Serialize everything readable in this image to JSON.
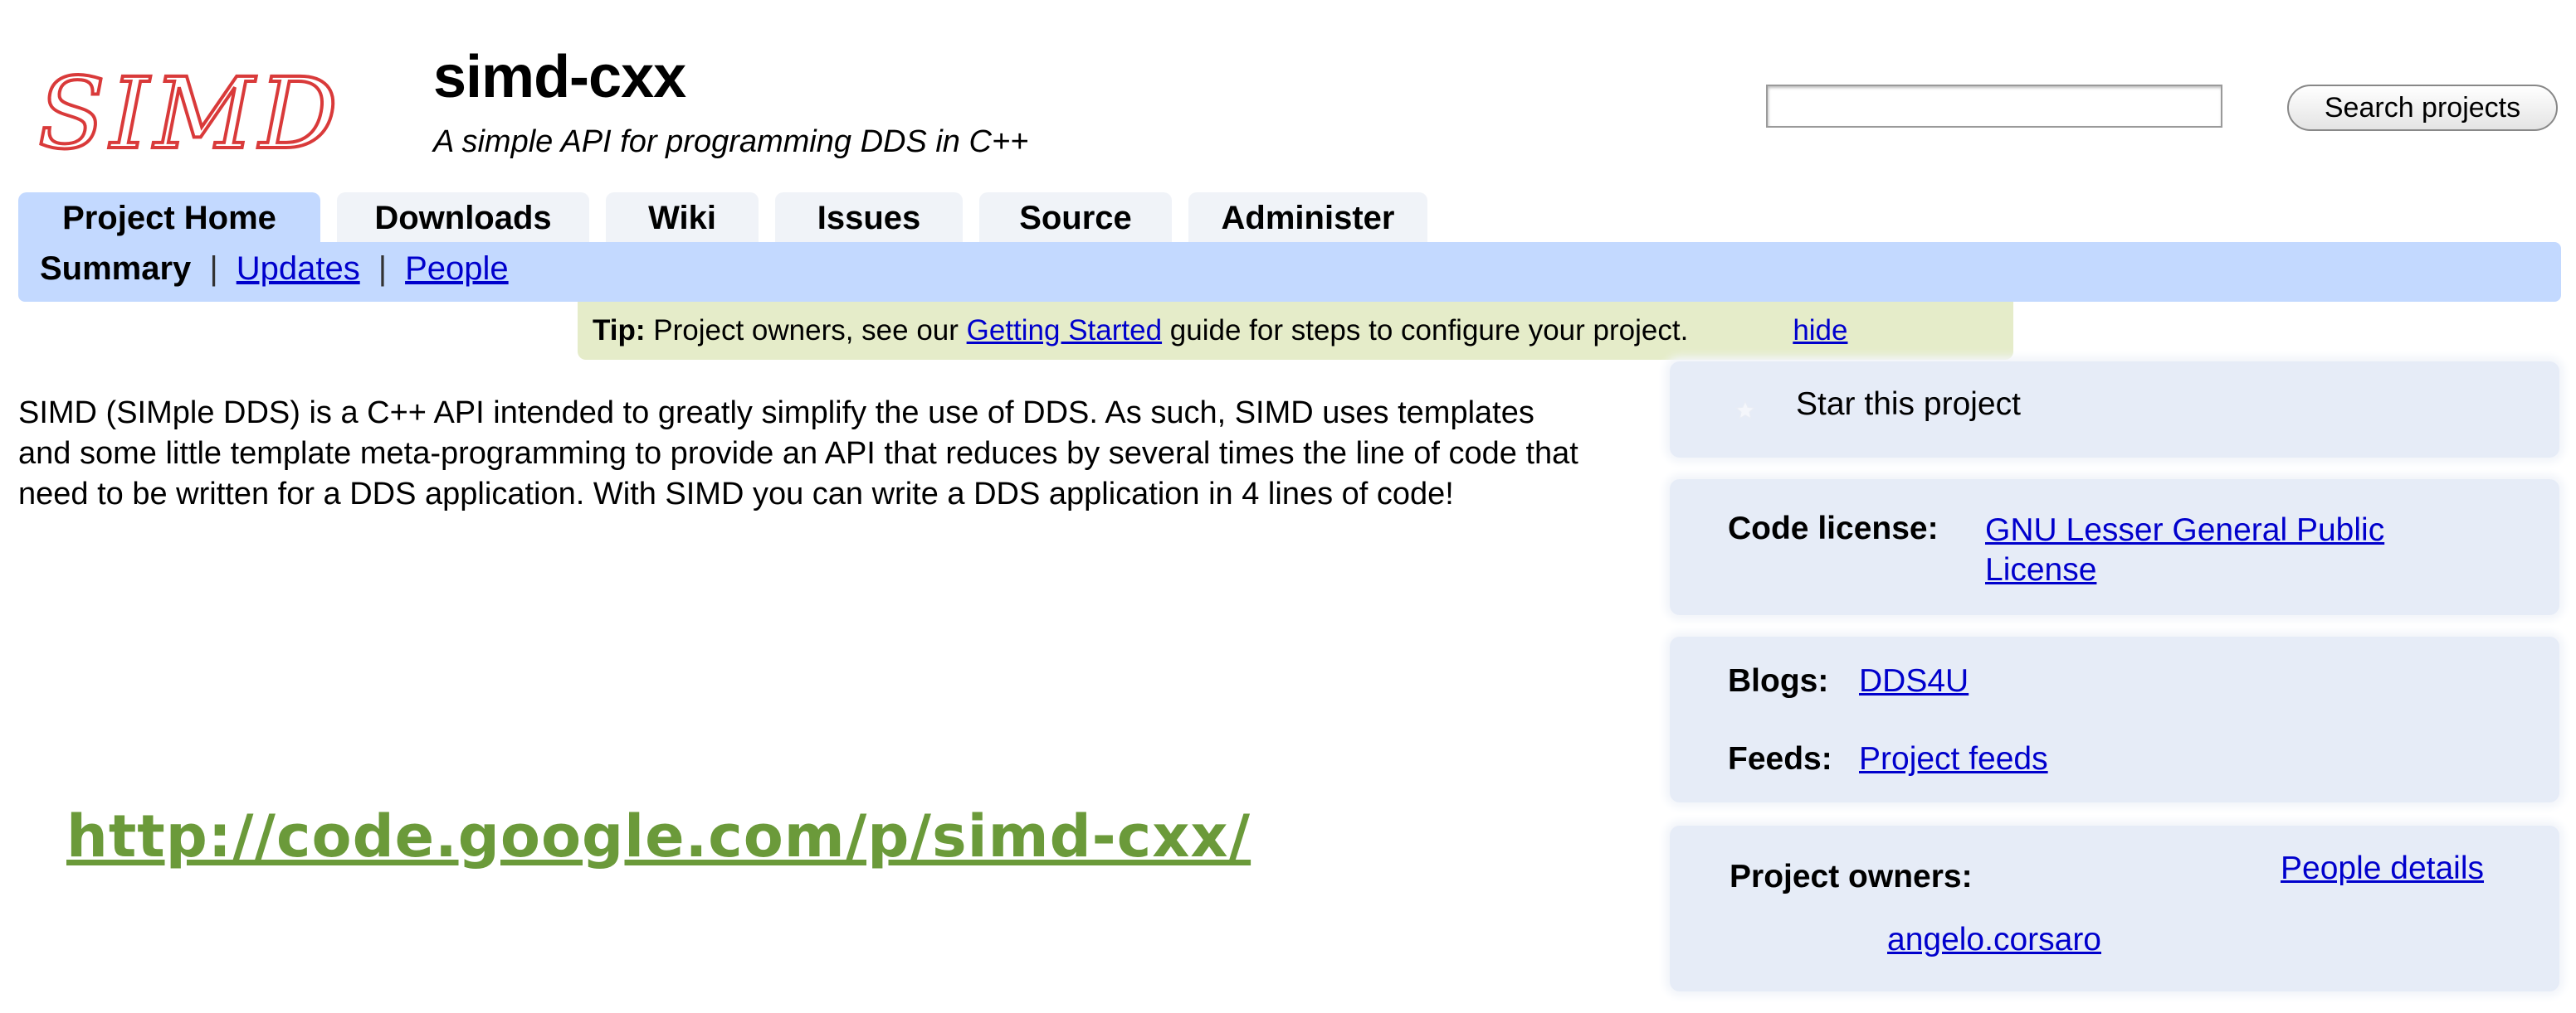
{
  "header": {
    "logo_text": "SIMD",
    "project_name": "simd-cxx",
    "project_summary": "A simple API for programming DDS in C++"
  },
  "search": {
    "input_value": "",
    "button_label": "Search projects"
  },
  "tabs": [
    {
      "label": "Project Home",
      "active": true
    },
    {
      "label": "Downloads",
      "active": false
    },
    {
      "label": "Wiki",
      "active": false
    },
    {
      "label": "Issues",
      "active": false
    },
    {
      "label": "Source",
      "active": false
    },
    {
      "label": "Administer",
      "active": false
    }
  ],
  "subnav": {
    "current": "Summary",
    "separator": "|",
    "links": [
      "Updates",
      "People"
    ]
  },
  "tip": {
    "prefix": "Tip:",
    "before": " Project owners, see our ",
    "link": "Getting Started",
    "after": " guide for steps to configure your project.",
    "hide_label": "hide"
  },
  "description": "SIMD (SIMple DDS) is a C++ API intended to greatly simplify the use of DDS. As such, SIMD uses templates and some little template meta-programming to provide an API that reduces by several times the line of code that need to be written for a DDS application. With SIMD you can write a DDS application in 4 lines of code!",
  "url_caption": "http://code.google.com/p/simd-cxx/",
  "sidebar": {
    "star_label": "Star this project",
    "license_label": "Code license:",
    "license_value": "GNU Lesser General Public License",
    "license_line1": "GNU Lesser General Public",
    "license_line2": "License",
    "blogs_label": "Blogs:",
    "blogs_value": "DDS4U",
    "feeds_label": "Feeds:",
    "feeds_value": "Project feeds",
    "owners_label": "Project owners:",
    "people_details_label": "People details",
    "owner_name": "angelo.corsaro"
  },
  "colors": {
    "tab_active": "#c3d9ff",
    "tip_background": "#e5ecc9",
    "link": "#0000cc",
    "url_caption": "#6b9a3a",
    "logo": "#d93a3a"
  }
}
